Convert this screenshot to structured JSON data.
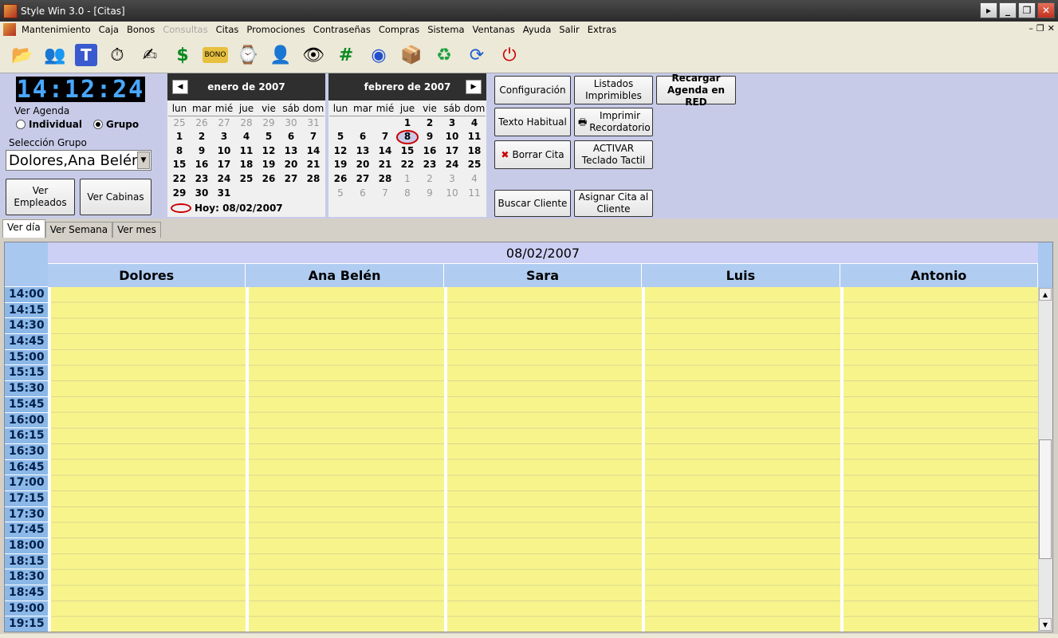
{
  "window": {
    "title": "Style Win 3.0 - [Citas]"
  },
  "menu": [
    "Mantenimiento",
    "Caja",
    "Bonos",
    "Consultas",
    "Citas",
    "Promociones",
    "Contraseñas",
    "Compras",
    "Sistema",
    "Ventanas",
    "Ayuda",
    "Salir",
    "Extras"
  ],
  "menu_disabled": "Consultas",
  "toolbar_icons": [
    "folder-icon",
    "users-icon",
    "text-t-icon",
    "clock-icon",
    "pen-icon",
    "money-icon",
    "bono-icon",
    "stopwatch-icon",
    "portrait-icon",
    "eye-icon",
    "grid-icon",
    "disk-icon",
    "box-icon",
    "recycle-icon",
    "refresh-icon",
    "power-icon"
  ],
  "clock": "14:12:24",
  "left": {
    "ver_agenda": "Ver Agenda",
    "individual": "Individual",
    "grupo": "Grupo",
    "seleccion_grupo": "Selección Grupo",
    "grupo_value": "Dolores,Ana Belén",
    "ver_empleados": "Ver Empleados",
    "ver_cabinas": "Ver Cabinas"
  },
  "cal1": {
    "title": "enero de 2007",
    "days": [
      "lun",
      "mar",
      "mié",
      "jue",
      "vie",
      "sáb",
      "dom"
    ],
    "cells": [
      [
        "25",
        "o"
      ],
      [
        "26",
        "o"
      ],
      [
        "27",
        "o"
      ],
      [
        "28",
        "o"
      ],
      [
        "29",
        "o"
      ],
      [
        "30",
        "o"
      ],
      [
        "31",
        "o"
      ],
      [
        "1",
        ""
      ],
      [
        "2",
        ""
      ],
      [
        "3",
        ""
      ],
      [
        "4",
        ""
      ],
      [
        "5",
        ""
      ],
      [
        "6",
        ""
      ],
      [
        "7",
        ""
      ],
      [
        "8",
        ""
      ],
      [
        "9",
        ""
      ],
      [
        "10",
        ""
      ],
      [
        "11",
        ""
      ],
      [
        "12",
        ""
      ],
      [
        "13",
        ""
      ],
      [
        "14",
        ""
      ],
      [
        "15",
        ""
      ],
      [
        "16",
        ""
      ],
      [
        "17",
        ""
      ],
      [
        "18",
        ""
      ],
      [
        "19",
        ""
      ],
      [
        "20",
        ""
      ],
      [
        "21",
        ""
      ],
      [
        "22",
        ""
      ],
      [
        "23",
        ""
      ],
      [
        "24",
        ""
      ],
      [
        "25",
        ""
      ],
      [
        "26",
        ""
      ],
      [
        "27",
        ""
      ],
      [
        "28",
        ""
      ],
      [
        "29",
        ""
      ],
      [
        "30",
        ""
      ],
      [
        "31",
        ""
      ],
      [
        "",
        ""
      ],
      [
        "",
        ""
      ],
      [
        "",
        ""
      ],
      [
        "",
        ""
      ]
    ],
    "hoy": "Hoy: 08/02/2007"
  },
  "cal2": {
    "title": "febrero de 2007",
    "days": [
      "lun",
      "mar",
      "mié",
      "jue",
      "vie",
      "sáb",
      "dom"
    ],
    "cells": [
      [
        "",
        ""
      ],
      [
        "",
        ""
      ],
      [
        "",
        ""
      ],
      [
        "1",
        ""
      ],
      [
        "2",
        ""
      ],
      [
        "3",
        ""
      ],
      [
        "4",
        ""
      ],
      [
        "5",
        ""
      ],
      [
        "6",
        ""
      ],
      [
        "7",
        ""
      ],
      [
        "8",
        "today"
      ],
      [
        "9",
        ""
      ],
      [
        "10",
        ""
      ],
      [
        "11",
        ""
      ],
      [
        "12",
        ""
      ],
      [
        "13",
        ""
      ],
      [
        "14",
        ""
      ],
      [
        "15",
        ""
      ],
      [
        "16",
        ""
      ],
      [
        "17",
        ""
      ],
      [
        "18",
        ""
      ],
      [
        "19",
        ""
      ],
      [
        "20",
        ""
      ],
      [
        "21",
        ""
      ],
      [
        "22",
        ""
      ],
      [
        "23",
        ""
      ],
      [
        "24",
        ""
      ],
      [
        "25",
        ""
      ],
      [
        "26",
        ""
      ],
      [
        "27",
        ""
      ],
      [
        "28",
        ""
      ],
      [
        "1",
        "o"
      ],
      [
        "2",
        "o"
      ],
      [
        "3",
        "o"
      ],
      [
        "4",
        "o"
      ],
      [
        "5",
        "o"
      ],
      [
        "6",
        "o"
      ],
      [
        "7",
        "o"
      ],
      [
        "8",
        "o"
      ],
      [
        "9",
        "o"
      ],
      [
        "10",
        "o"
      ],
      [
        "11",
        "o"
      ]
    ]
  },
  "buttons": {
    "configuracion": "Configuración",
    "listados": "Listados Imprimibles",
    "recargar": "Recargar Agenda en RED",
    "texto_habitual": "Texto Habitual",
    "imprimir": "Imprimir Recordatorio",
    "borrar": "Borrar Cita",
    "activar": "ACTIVAR Teclado Tactil",
    "buscar": "Buscar Cliente",
    "asignar": "Asignar Cita al Cliente"
  },
  "tabs": [
    "Ver día",
    "Ver Semana",
    "Ver mes"
  ],
  "agenda": {
    "date": "08/02/2007",
    "employees": [
      "Dolores",
      "Ana Belén",
      "Sara",
      "Luis",
      "Antonio"
    ],
    "times": [
      "14:00",
      "14:15",
      "14:30",
      "14:45",
      "15:00",
      "15:15",
      "15:30",
      "15:45",
      "16:00",
      "16:15",
      "16:30",
      "16:45",
      "17:00",
      "17:15",
      "17:30",
      "17:45",
      "18:00",
      "18:15",
      "18:30",
      "18:45",
      "19:00",
      "19:15"
    ]
  }
}
